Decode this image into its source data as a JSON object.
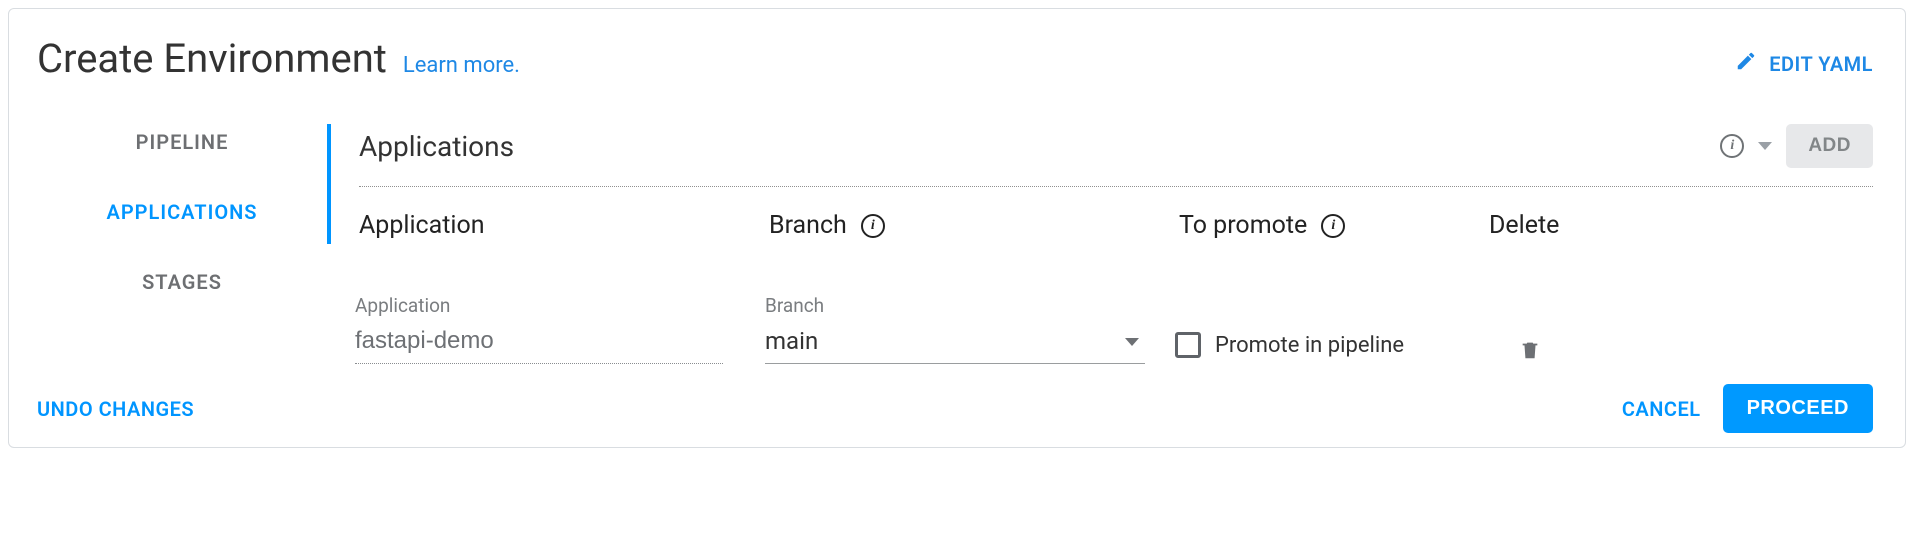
{
  "header": {
    "title": "Create Environment",
    "learn_more": "Learn more.",
    "edit_yaml": "EDIT YAML"
  },
  "sidebar": {
    "items": [
      {
        "label": "PIPELINE"
      },
      {
        "label": "APPLICATIONS"
      },
      {
        "label": "STAGES"
      }
    ]
  },
  "section": {
    "title": "Applications",
    "add_label": "ADD"
  },
  "columns": {
    "application": "Application",
    "branch": "Branch",
    "to_promote": "To promote",
    "delete": "Delete"
  },
  "row": {
    "app_label": "Application",
    "app_value": "fastapi-demo",
    "branch_label": "Branch",
    "branch_value": "main",
    "promote_label": "Promote in pipeline"
  },
  "footer": {
    "undo": "UNDO CHANGES",
    "cancel": "CANCEL",
    "proceed": "PROCEED"
  }
}
